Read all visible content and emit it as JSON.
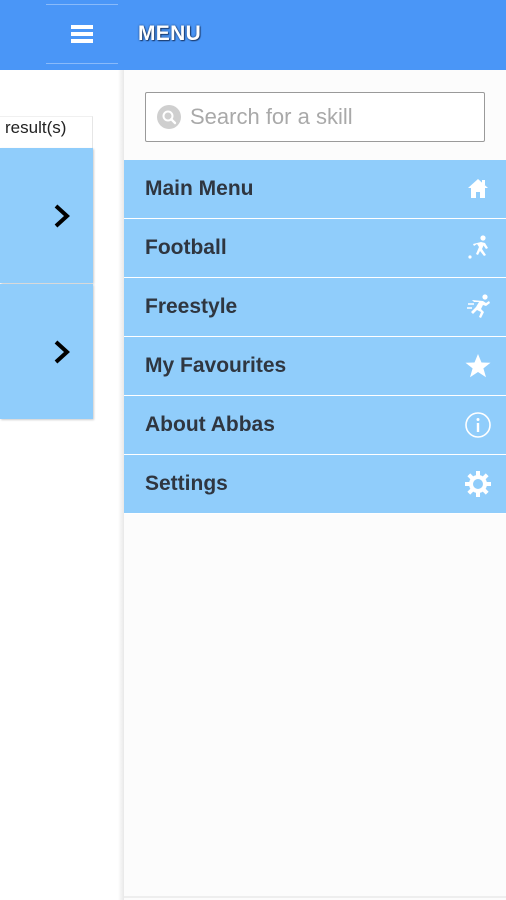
{
  "appbar": {
    "title": "MENU",
    "hamburger_icon": "hamburger-menu-icon",
    "color": "#4a96f7"
  },
  "underlay": {
    "result_count": "result(s)",
    "cards": [
      {
        "icon": "chevron-right-icon"
      },
      {
        "icon": "chevron-right-icon"
      }
    ]
  },
  "drawer": {
    "search": {
      "placeholder": "Search for a skill",
      "value": "",
      "icon": "search-icon"
    },
    "items": [
      {
        "label": "Main Menu",
        "icon": "home-icon"
      },
      {
        "label": "Football",
        "icon": "football-player-icon"
      },
      {
        "label": "Freestyle",
        "icon": "freestyle-player-icon"
      },
      {
        "label": "My Favourites",
        "icon": "star-icon"
      },
      {
        "label": "About Abbas",
        "icon": "info-icon"
      },
      {
        "label": "Settings",
        "icon": "gear-icon"
      }
    ],
    "item_color": "#90cdfb"
  }
}
